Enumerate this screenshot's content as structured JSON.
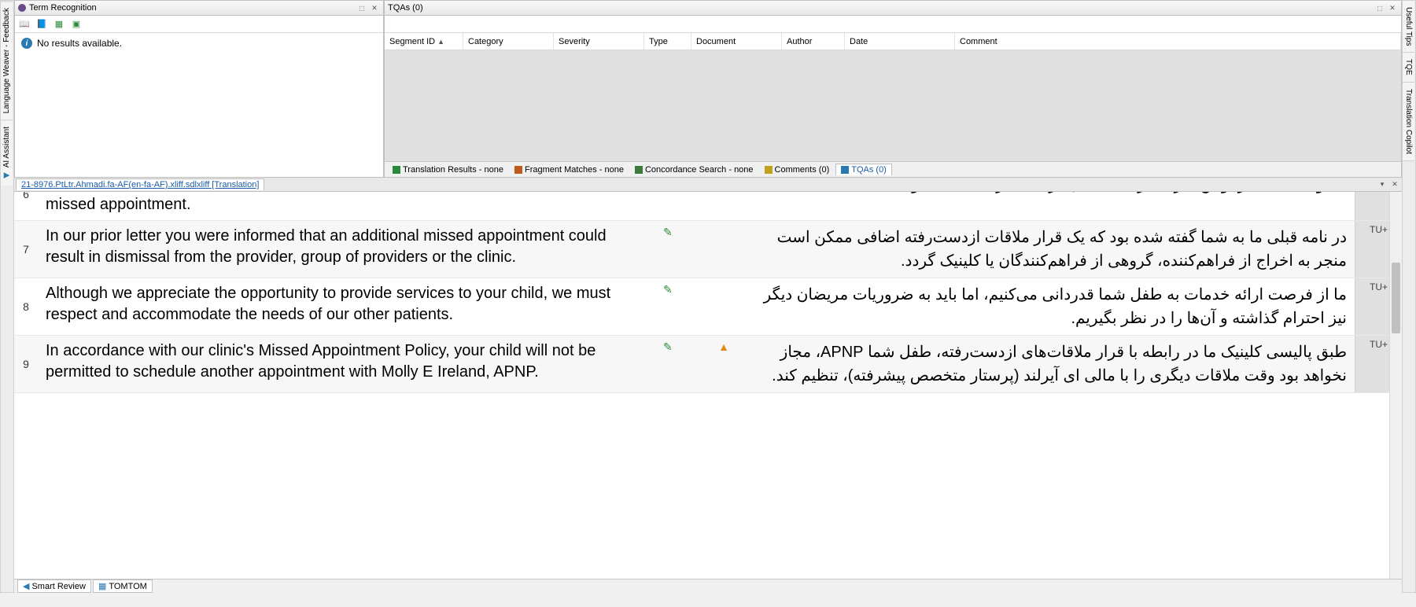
{
  "left_tabs": [
    "Language Weaver - Feedback",
    "AI Assistant"
  ],
  "right_tabs": [
    "Useful Tips",
    "TQE",
    "Translation Copilot"
  ],
  "term_panel": {
    "title": "Term Recognition",
    "no_results": "No results available."
  },
  "tqa_panel": {
    "title": "TQAs (0)",
    "columns": [
      "Segment ID",
      "Category",
      "Severity",
      "Type",
      "Document",
      "Author",
      "Date",
      "Comment"
    ]
  },
  "result_tabs": [
    {
      "label": "Translation Results - none",
      "color": "#2a8a3a"
    },
    {
      "label": "Fragment Matches - none",
      "color": "#c05a1a"
    },
    {
      "label": "Concordance Search - none",
      "color": "#3a7a3a"
    },
    {
      "label": "Comments (0)",
      "color": "#c0a020"
    },
    {
      "label": "TQAs (0)",
      "color": "#2a7ab0",
      "active": true
    }
  ],
  "doc_tab": "21-8976.PtLtr.Ahmadi.fa-AF(en-fa-AF).xliff.sdlxliff [Translation]",
  "segments": [
    {
      "num": "6",
      "src": "Appointment Policy was included in the letter you received after your child's first missed appointment.",
      "tgt": "مکتوبی که بعد از اولین غیرحاضری طفل‌تان دریافت کردید، شامل بود.",
      "badge": "",
      "status": "",
      "partial": true
    },
    {
      "num": "7",
      "src": "In our prior letter you were informed that an additional missed appointment could result in dismissal from the provider, group of providers or the clinic.",
      "tgt": "در نامه قبلی ما به شما گفته شده بود که یک قرار ملاقات ازدست‌رفته اضافی ممکن است منجر به اخراج از فراهم‌کننده، گروهی از فراهم‌کنندگان یا کلینیک گردد.",
      "badge": "TU+",
      "status": "pencil"
    },
    {
      "num": "8",
      "src": "Although we appreciate the opportunity to provide services to your child, we must respect and accommodate the needs of our other patients.",
      "tgt": "ما از فرصت ارائه خدمات به طفل شما قدردانی می‌کنیم، اما باید به ضروریات مریضان دیگر نیز احترام گذاشته و آن‌ها را در نظر بگیریم.",
      "badge": "TU+",
      "status": "pencil"
    },
    {
      "num": "9",
      "src": "In accordance with our clinic's Missed Appointment Policy, your child will not be permitted to schedule another appointment with Molly E Ireland, APNP.",
      "tgt": "طبق پالیسی کلینیک ما در رابطه با قرار ملاقات‌های ازدست‌رفته، طفل شما APNP، مجاز نخواهد بود وقت ملاقات دیگری را با مالی ای آیرلند (پرستار متخصص پیشرفته)، تنظیم کند.",
      "badge": "TU+",
      "status": "pencil-warn"
    }
  ],
  "bottom_tabs": [
    {
      "label": "Smart Review",
      "icon": "◀",
      "color": "#2a7ab0"
    },
    {
      "label": "TOMTOM",
      "icon": "▦",
      "color": "#2a7ab0"
    }
  ]
}
